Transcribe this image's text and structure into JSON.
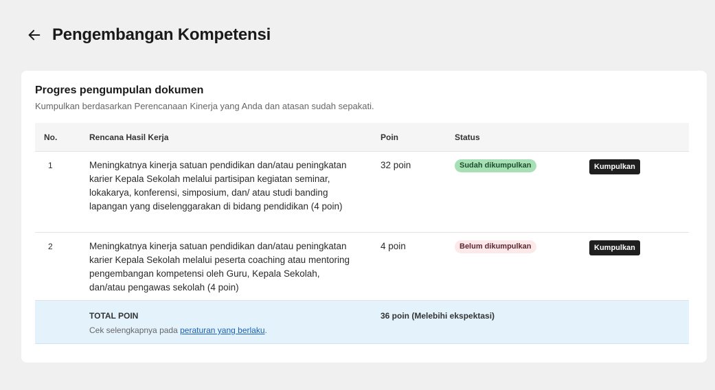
{
  "header": {
    "title": "Pengembangan Kompetensi",
    "back_icon": "arrow-left-icon"
  },
  "card": {
    "title": "Progres pengumpulan dokumen",
    "subtitle": "Kumpulkan berdasarkan Perencanaan Kinerja yang Anda dan atasan sudah sepakati."
  },
  "table": {
    "headers": {
      "no": "No.",
      "rhk": "Rencana Hasil Kerja",
      "poin": "Poin",
      "status": "Status"
    },
    "rows": [
      {
        "no": "1",
        "rhk": "Meningkatnya kinerja satuan pendidikan dan/atau peningkatan karier Kepala Sekolah melalui partisipan kegiatan seminar, lokakarya, konferensi, simposium, dan/ atau studi banding lapangan yang diselenggarakan di bidang pendidikan (4 poin)",
        "poin": "32 poin",
        "status": "Sudah dikumpulkan",
        "action": "Kumpulkan"
      },
      {
        "no": "2",
        "rhk": "Meningkatnya kinerja satuan pendidikan dan/atau peningkatan karier Kepala Sekolah melalui peserta coaching atau mentoring pengembangan kompetensi oleh Guru, Kepala Sekolah, dan/atau pengawas sekolah (4 poin)",
        "poin": "4 poin",
        "status": "Belum dikumpulkan",
        "action": "Kumpulkan"
      }
    ],
    "total": {
      "label": "TOTAL POIN",
      "note_prefix": "Cek selengkapnya pada ",
      "note_link": "peraturan yang berlaku",
      "note_suffix": ".",
      "value": "36 poin (Melebihi ekspektasi)"
    }
  },
  "colors": {
    "badge_done_bg": "#a8e0b6",
    "badge_pending_bg": "#fde8ea",
    "button_bg": "#1f1f1f",
    "total_bg": "#e3f2fb",
    "link": "#1a5fb4"
  }
}
